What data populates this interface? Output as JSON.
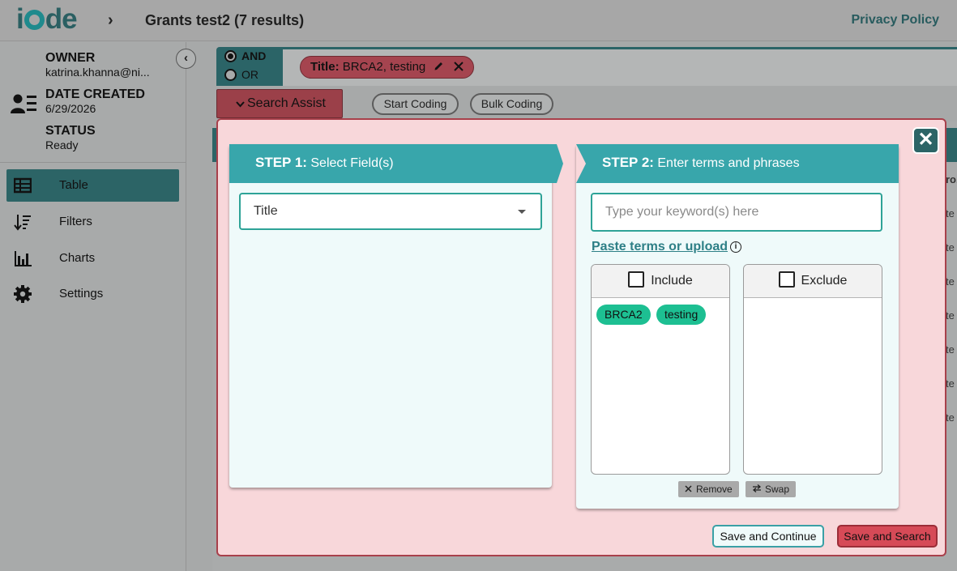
{
  "header": {
    "logo_pre": "i",
    "logo_post": "de",
    "crumb_chevron": "›",
    "title": "Grants test2 (7 results)",
    "privacy": "Privacy Policy"
  },
  "sidebar": {
    "collapse_glyph": "‹",
    "owner_label": "OWNER",
    "owner_value": "katrina.khanna@ni...",
    "date_label": "DATE CREATED",
    "date_value": "6/29/2026",
    "status_label": "STATUS",
    "status_value": "Ready",
    "nav": [
      {
        "label": "Table",
        "icon": "table-icon",
        "active": true
      },
      {
        "label": "Filters",
        "icon": "sort-filter-icon",
        "active": false
      },
      {
        "label": "Charts",
        "icon": "bar-chart-icon",
        "active": false
      },
      {
        "label": "Settings",
        "icon": "gear-icon",
        "active": false
      }
    ]
  },
  "search": {
    "and_label": "AND",
    "or_label": "OR",
    "selected_operator": "AND",
    "query_chip_field": "Title:",
    "query_chip_terms": " BRCA2, testing",
    "search_assist": "Search Assist",
    "start_coding": "Start Coding",
    "bulk_coding": "Bulk Coding"
  },
  "background_cells": [
    "ro.",
    "te",
    "te",
    "te",
    "te",
    "te",
    "te",
    "te"
  ],
  "modal": {
    "close_glyph": "✕",
    "step1_num": "STEP 1:",
    "step1_text": " Select Field(s)",
    "field_value": "Title",
    "step2_num": "STEP 2:",
    "step2_text": " Enter terms and phrases",
    "keyword_placeholder": "Type your keyword(s) here",
    "paste_link": "Paste terms or upload",
    "info_glyph": "i",
    "include_label": "Include",
    "exclude_label": "Exclude",
    "include_terms": [
      "BRCA2",
      "testing"
    ],
    "remove_label": "Remove",
    "swap_label": "Swap",
    "save_continue": "Save and Continue",
    "save_search": "Save and Search"
  },
  "colors": {
    "teal_dark": "#2c6466",
    "teal_step": "#38a6ab",
    "chip_green": "#1dbf92",
    "modal_bg": "#f8d7da",
    "accent_red": "#d64a57"
  }
}
